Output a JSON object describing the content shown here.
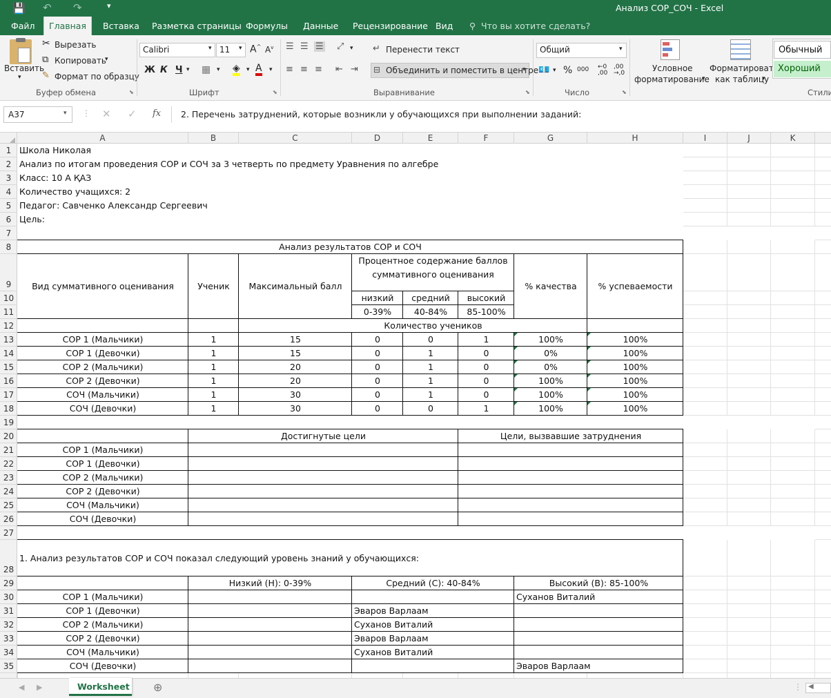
{
  "window": {
    "title": "Анализ СОР_СОЧ - Excel"
  },
  "tabs": [
    "Файл",
    "Главная",
    "Вставка",
    "Разметка страницы",
    "Формулы",
    "Данные",
    "Рецензирование",
    "Вид"
  ],
  "tell_me": "Что вы хотите сделать?",
  "ribbon": {
    "clipboard": {
      "paste": "Вставить",
      "cut": "Вырезать",
      "copy": "Копировать",
      "format_painter": "Формат по образцу",
      "group": "Буфер обмена"
    },
    "font": {
      "name": "Calibri",
      "size": "11",
      "bold": "Ж",
      "italic": "К",
      "underline": "Ч",
      "group": "Шрифт"
    },
    "alignment": {
      "wrap": "Перенести текст",
      "merge": "Объединить и поместить в центре",
      "group": "Выравнивание"
    },
    "number": {
      "format": "Общий",
      "percent": "%",
      "thousands": "000",
      "group": "Число"
    },
    "styles": {
      "conditional_1": "Условное",
      "conditional_2": "форматирование",
      "table_1": "Форматировать",
      "table_2": "как таблицу",
      "normal": "Обычный",
      "good": "Хороший",
      "group": "Стили"
    }
  },
  "formula_bar": {
    "name_box": "A37",
    "fx": "fx",
    "content": "2. Перечень затруднений, которые возникли у обучающихся при выполнении заданий:"
  },
  "columns": [
    "A",
    "B",
    "C",
    "D",
    "E",
    "F",
    "G",
    "H",
    "I",
    "J",
    "K"
  ],
  "rows": [
    "1",
    "2",
    "3",
    "4",
    "5",
    "6",
    "7",
    "8",
    "9",
    "10",
    "11",
    "12",
    "13",
    "14",
    "15",
    "16",
    "17",
    "18",
    "19",
    "20",
    "21",
    "22",
    "23",
    "24",
    "25",
    "26",
    "27",
    "28",
    "29",
    "30",
    "31",
    "32",
    "33",
    "34",
    "35"
  ],
  "sheet": {
    "header": [
      "Школа Николая",
      "Анализ по итогам проведения СОР и СОЧ за 3 четверть по предмету Уравнения по алгебре",
      "Класс: 10 А ҚАЗ",
      "Количество учащихся: 2",
      "Педагог: Савченко Александр Сергеевич",
      "Цель:"
    ],
    "t1": {
      "title": "Анализ результатов СОР и СОЧ",
      "col_type": "Вид суммативного оценивания",
      "col_student": "Ученик",
      "col_max": "Максимальный балл",
      "col_pct_1": "Процентное содержание баллов",
      "col_pct_2": "суммативного оценивания",
      "low": "низкий",
      "mid": "средний",
      "high": "высокий",
      "low_r": "0-39%",
      "mid_r": "40-84%",
      "high_r": "85-100%",
      "quality": "% качества",
      "success": "% успеваемости",
      "count": "Количество учеников",
      "rows": [
        [
          "СОР 1 (Мальчики)",
          "1",
          "15",
          "0",
          "0",
          "1",
          "100%",
          "100%"
        ],
        [
          "СОР 1 (Девочки)",
          "1",
          "15",
          "0",
          "1",
          "0",
          "0%",
          "100%"
        ],
        [
          "СОР 2 (Мальчики)",
          "1",
          "20",
          "0",
          "1",
          "0",
          "0%",
          "100%"
        ],
        [
          "СОР 2 (Девочки)",
          "1",
          "20",
          "0",
          "1",
          "0",
          "100%",
          "100%"
        ],
        [
          "СОЧ (Мальчики)",
          "1",
          "30",
          "0",
          "1",
          "0",
          "100%",
          "100%"
        ],
        [
          "СОЧ (Девочки)",
          "1",
          "30",
          "0",
          "0",
          "1",
          "100%",
          "100%"
        ]
      ]
    },
    "t2": {
      "achieved": "Достигнутые цели",
      "difficult": "Цели, вызвавшие затруднения",
      "rows": [
        "СОР 1 (Мальчики)",
        "СОР 1 (Девочки)",
        "СОР 2 (Мальчики)",
        "СОР 2 (Девочки)",
        "СОЧ (Мальчики)",
        "СОЧ (Девочки)"
      ]
    },
    "analysis": "1. Анализ результатов СОР и СОЧ показал следующий уровень знаний у обучающихся:",
    "t3": {
      "low": "Низкий (Н): 0-39%",
      "mid": "Средний (С): 40-84%",
      "high": "Высокий (В): 85-100%",
      "rows": [
        [
          "СОР 1 (Мальчики)",
          "",
          "",
          "Суханов Виталий"
        ],
        [
          "СОР 1 (Девочки)",
          "",
          "Эваров Варлаам",
          ""
        ],
        [
          "СОР 2 (Мальчики)",
          "",
          "Суханов Виталий",
          ""
        ],
        [
          "СОР 2 (Девочки)",
          "",
          "Эваров Варлаам",
          ""
        ],
        [
          "СОЧ (Мальчики)",
          "",
          "Суханов Виталий",
          ""
        ],
        [
          "СОЧ (Девочки)",
          "",
          "",
          "Эваров Варлаам"
        ]
      ]
    }
  },
  "sheet_tab": "Worksheet",
  "colors": {
    "accent": "#217346",
    "good_fill": "#c6efce",
    "good_text": "#006100"
  }
}
